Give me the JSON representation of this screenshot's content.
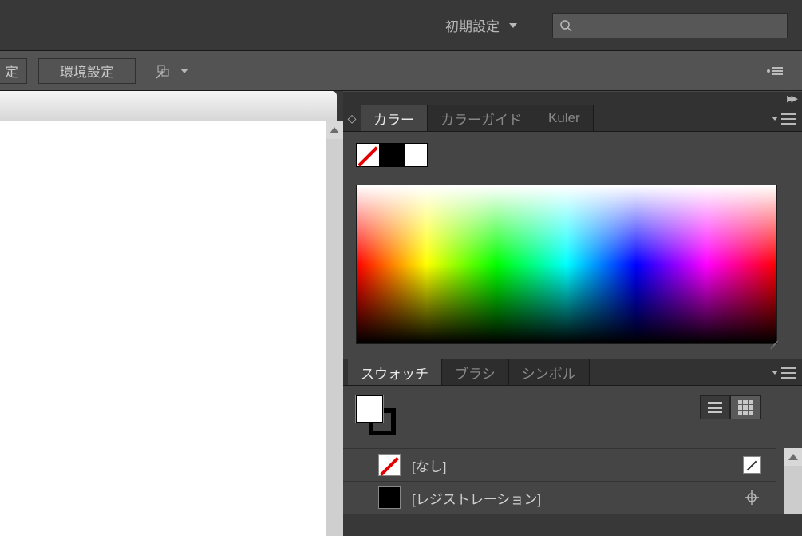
{
  "topbar": {
    "workspace_label": "初期設定",
    "search_placeholder": ""
  },
  "optionsbar": {
    "button_left_partial": "定",
    "button_prefs": "環境設定"
  },
  "panels": {
    "color": {
      "tabs": [
        "カラー",
        "カラーガイド",
        "Kuler"
      ],
      "active_index": 0
    },
    "swatches": {
      "tabs": [
        "スウォッチ",
        "ブラシ",
        "シンボル"
      ],
      "active_index": 0,
      "items": [
        {
          "name": "[なし]",
          "type": "none"
        },
        {
          "name": "[レジストレーション]",
          "type": "registration"
        }
      ]
    }
  }
}
